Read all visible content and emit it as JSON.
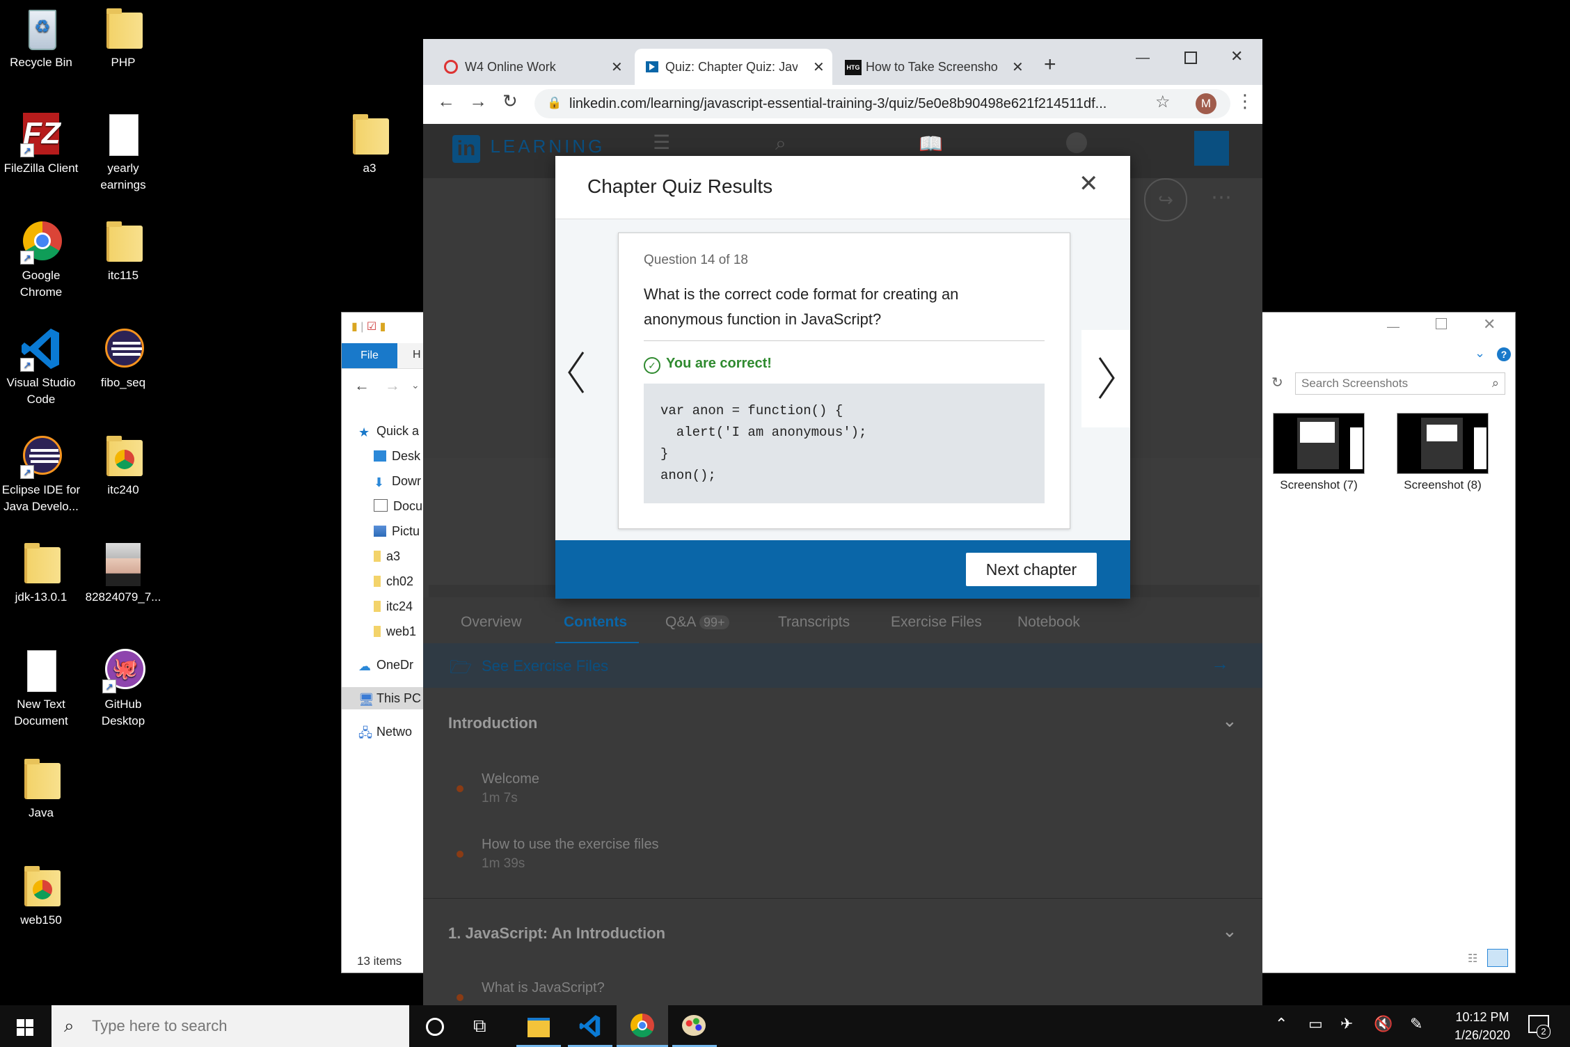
{
  "desktop": {
    "icons": [
      {
        "label": "Recycle Bin"
      },
      {
        "label": "PHP"
      },
      {
        "label": "FileZilla Client"
      },
      {
        "label": "yearly earnings"
      },
      {
        "label": "a3"
      },
      {
        "label": "Google Chrome"
      },
      {
        "label": "itc115"
      },
      {
        "label": "Visual Studio Code"
      },
      {
        "label": "fibo_seq"
      },
      {
        "label": "Eclipse IDE for Java Develo..."
      },
      {
        "label": "itc240"
      },
      {
        "label": "jdk-13.0.1"
      },
      {
        "label": "82824079_7..."
      },
      {
        "label": "New Text Document"
      },
      {
        "label": "GitHub Desktop"
      },
      {
        "label": "Java"
      },
      {
        "label": "web150"
      }
    ]
  },
  "explorer_left": {
    "ribbon_file": "File",
    "ribbon_home": "H",
    "nav": [
      "Quick a",
      "Desk",
      "Dowr",
      "Docu",
      "Pictu",
      "a3",
      "ch02",
      "itc24",
      "web1",
      "OneDr",
      "This PC",
      "Netwo"
    ],
    "status": "13 items"
  },
  "explorer_right": {
    "search_placeholder": "Search Screenshots",
    "help": "?",
    "files": [
      "Screenshot (7)",
      "Screenshot (8)"
    ]
  },
  "browser": {
    "tabs": [
      {
        "label": "W4 Online Work"
      },
      {
        "label": "Quiz: Chapter Quiz: Java"
      },
      {
        "label": "How to Take Screenshot"
      }
    ],
    "new_tab": "+",
    "favicon_htg": "HTG",
    "url": "linkedin.com/learning/javascript-essential-training-3/quiz/5e0e8b90498e621f214511df...",
    "avatar": "M"
  },
  "linkedin": {
    "logo_in": "in",
    "logo_text": "LEARNING",
    "tabs": [
      "Overview",
      "Contents",
      "Q&A",
      "Transcripts",
      "Exercise Files",
      "Notebook"
    ],
    "qa_badge": "99+",
    "see_exercise_files": "See Exercise Files",
    "sections": [
      {
        "title": "Introduction",
        "items": [
          {
            "title": "Welcome",
            "duration": "1m 7s"
          },
          {
            "title": "How to use the exercise files",
            "duration": "1m 39s"
          }
        ]
      },
      {
        "title": "1. JavaScript: An Introduction",
        "items": [
          {
            "title": "What is JavaScript?",
            "duration": ""
          }
        ]
      }
    ]
  },
  "modal": {
    "title": "Chapter Quiz Results",
    "question_counter": "Question 14 of 18",
    "question_line1": "What is the correct code format for creating an",
    "question_line2": "anonymous function in JavaScript?",
    "result": "You are correct!",
    "code": "var anon = function() {\n  alert('I am anonymous');\n}\nanon();",
    "next_button": "Next chapter",
    "accent": "#0a66a8",
    "success": "#2f8a2f"
  },
  "taskbar": {
    "search_placeholder": "Type here to search",
    "time": "10:12 PM",
    "date": "1/26/2020",
    "notification_count": "2"
  }
}
